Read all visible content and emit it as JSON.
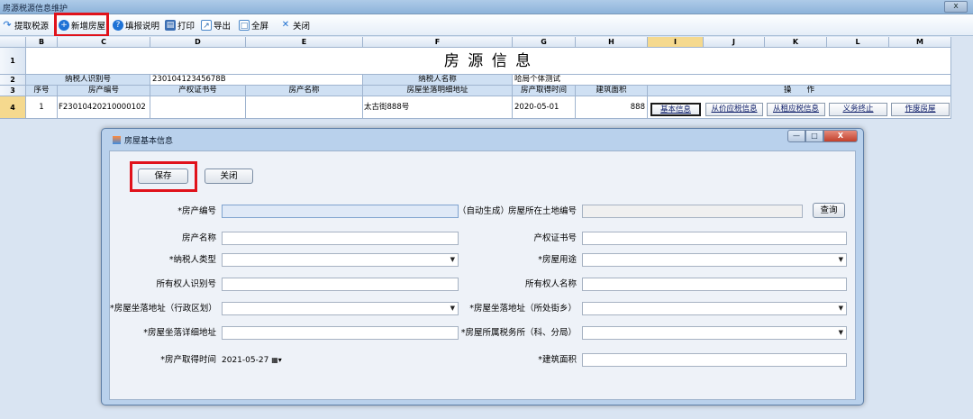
{
  "window": {
    "title": "房源税源信息维护",
    "close_glyph": "x"
  },
  "toolbar": {
    "items": [
      {
        "label": "提取税源",
        "icon": "refresh-arrow-icon"
      },
      {
        "label": "新增房屋",
        "icon": "plus-circle-icon"
      },
      {
        "label": "填报说明",
        "icon": "help-icon"
      },
      {
        "label": "打印",
        "icon": "printer-icon"
      },
      {
        "label": "导出",
        "icon": "export-icon"
      },
      {
        "label": "全屏",
        "icon": "fullscreen-icon"
      },
      {
        "label": "关闭",
        "icon": "close-x-icon"
      }
    ]
  },
  "sheet": {
    "columns": [
      "B",
      "C",
      "D",
      "E",
      "F",
      "G",
      "H",
      "I",
      "J",
      "K",
      "L",
      "M"
    ],
    "rows": [
      "1",
      "2",
      "3",
      "4"
    ],
    "title": "房 源 信 息",
    "taxpayer_id_label": "纳税人识别号",
    "taxpayer_id_value": "23010412345678B",
    "taxpayer_name_label": "纳税人名称",
    "taxpayer_name_value": "哈局个体测试",
    "headers": [
      "序号",
      "房产编号",
      "产权证书号",
      "房产名称",
      "房屋坐落明细地址",
      "房产取得时间",
      "建筑面积",
      "操　　作"
    ],
    "row": {
      "seq": "1",
      "property_no": "F23010420210000102",
      "cert_no": "",
      "name": "",
      "address": "太古街888号",
      "date": "2020-05-01",
      "area": "888"
    },
    "actions": [
      "基本信息",
      "从价应税信息",
      "从租应税信息",
      "义务终止",
      "作废房屋"
    ]
  },
  "dialog": {
    "title": "房屋基本信息",
    "min_glyph": "—",
    "max_glyph": "□",
    "close_glyph": "X",
    "save": "保存",
    "close": "关闭",
    "fields": {
      "property_no_label": "*房产编号",
      "property_no_value": "",
      "auto_gen": "（自动生成）",
      "land_no_label": "房屋所在土地编号",
      "query": "查询",
      "name_label": "房产名称",
      "cert_label": "产权证书号",
      "taxpayer_type_label": "*纳税人类型",
      "usage_label": "*房屋用途",
      "owner_id_label": "所有权人识别号",
      "owner_name_label": "所有权人名称",
      "district_label": "*房屋坐落地址（行政区划）",
      "street_label": "*房屋坐落地址（所处街乡）",
      "detail_addr_label": "*房屋坐落详细地址",
      "tax_office_label": "*房屋所属税务所（科、分局）",
      "acq_date_label": "*房产取得时间",
      "acq_date_value": "2021-05-27",
      "area_label": "*建筑面积"
    }
  },
  "colors": {
    "highlight": "#e0121b",
    "sheet_bg": "#d9e4f2",
    "dialog_bg": "#b9d1ec"
  }
}
